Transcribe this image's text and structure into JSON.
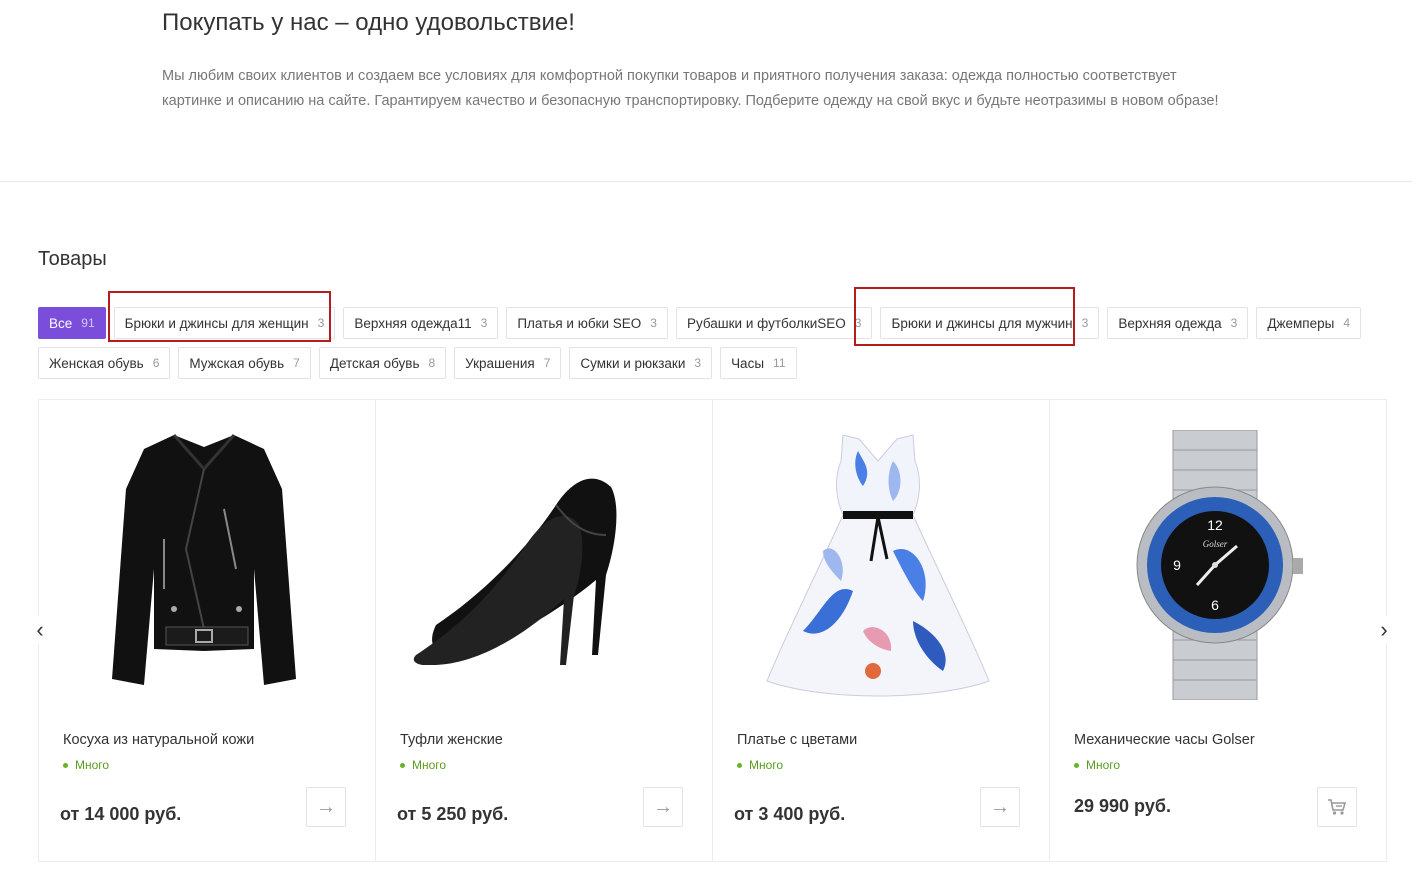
{
  "intro": {
    "title": "Покупать у нас – одно удовольствие!",
    "text_line1": "Мы любим своих клиентов и создаем все условиях для комфортной покупки товаров и приятного получения заказа: одежда полностью соответствует",
    "text_line2": "картинке и описанию на сайте. Гарантируем качество и безопасную транспортировку. Подберите одежду на свой вкус и будьте неотразимы в новом образе!"
  },
  "section": {
    "title": "Товары"
  },
  "tabs": [
    {
      "label": "Все",
      "count": "91",
      "active": true
    },
    {
      "label": "Брюки и джинсы для женщин",
      "count": "3"
    },
    {
      "label": "Верхняя одежда11",
      "count": "3"
    },
    {
      "label": "Платья и юбки SEO",
      "count": "3"
    },
    {
      "label": "Рубашки и футболкиSEO",
      "count": "3"
    },
    {
      "label": "Брюки и джинсы для мужчин",
      "count": "3"
    },
    {
      "label": "Верхняя одежда",
      "count": "3"
    },
    {
      "label": "Джемперы",
      "count": "4"
    },
    {
      "label": "Женская обувь",
      "count": "6"
    },
    {
      "label": "Мужская обувь",
      "count": "7"
    },
    {
      "label": "Детская обувь",
      "count": "8"
    },
    {
      "label": "Украшения",
      "count": "7"
    },
    {
      "label": "Сумки и рюкзаки",
      "count": "3"
    },
    {
      "label": "Часы",
      "count": "11"
    }
  ],
  "products": [
    {
      "name": "Косуха из натуральной кожи",
      "stock": "Много",
      "price": "от 14 000 руб.",
      "action_icon": "arrow-right-icon"
    },
    {
      "name": "Туфли женские",
      "stock": "Много",
      "price": "от 5 250 руб.",
      "action_icon": "arrow-right-icon"
    },
    {
      "name": "Платье с цветами",
      "stock": "Много",
      "price": "от 3 400 руб.",
      "action_icon": "arrow-right-icon"
    },
    {
      "name": "Механические часы Golser",
      "stock": "Много",
      "price": "29 990 руб.",
      "action_icon": "cart-icon"
    }
  ],
  "watch_brand": "Golser",
  "colors": {
    "accent": "#7b4ddb",
    "stock": "#6ab329",
    "highlight": "#b71c1c"
  }
}
